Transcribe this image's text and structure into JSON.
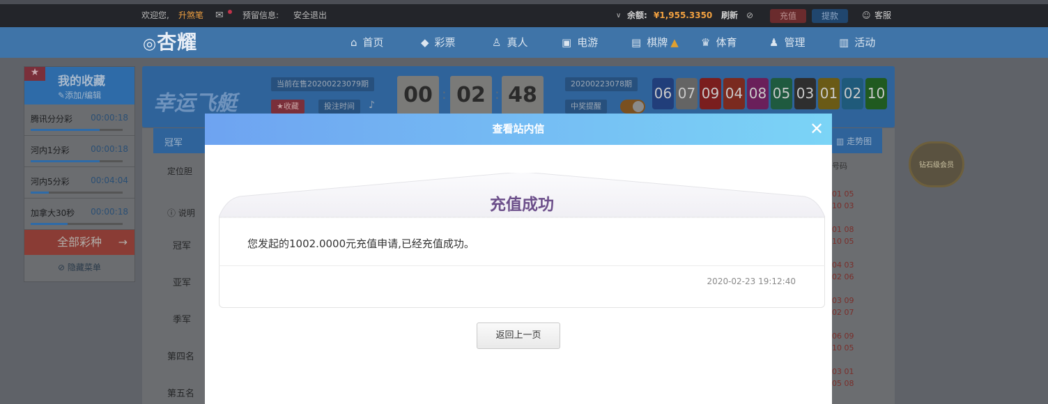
{
  "topbar": {
    "welcome": "欢迎您,",
    "username": "升煞笔",
    "notice_label": "预留信息:",
    "logout": "安全退出",
    "balance_label": "余额:",
    "balance": "¥1,955.3350",
    "refresh": "刷新",
    "recharge": "充值",
    "withdraw": "提款",
    "service": "客服"
  },
  "nav": {
    "logo": "杏耀",
    "items": [
      {
        "label": "首页",
        "icon": "home-icon",
        "glyph": "⌂"
      },
      {
        "label": "彩票",
        "icon": "ticket-icon",
        "glyph": "◆"
      },
      {
        "label": "真人",
        "icon": "person-icon",
        "glyph": "♙"
      },
      {
        "label": "电游",
        "icon": "arcade-icon",
        "glyph": "▣"
      },
      {
        "label": "棋牌",
        "icon": "cards-icon",
        "glyph": "▤"
      },
      {
        "label": "体育",
        "icon": "trophy-icon",
        "glyph": "♛"
      },
      {
        "label": "管理",
        "icon": "users-icon",
        "glyph": "♟"
      },
      {
        "label": "活动",
        "icon": "gift-icon",
        "glyph": "▥"
      }
    ]
  },
  "favorites": {
    "title": "我的收藏",
    "edit": "添加/编辑",
    "items": [
      {
        "name": "腾讯分分彩",
        "time": "00:00:18",
        "progress": 0.75
      },
      {
        "name": "河内1分彩",
        "time": "00:00:18",
        "progress": 0.75
      },
      {
        "name": "河内5分彩",
        "time": "00:04:04",
        "progress": 0.2
      },
      {
        "name": "加拿大30秒",
        "time": "00:00:18",
        "progress": 0.4
      }
    ],
    "all_games": "全部彩种",
    "hide_menu": "隐藏菜单"
  },
  "lottery": {
    "name": "幸运飞艇",
    "current_period": "当前在售20200223079期",
    "collect": "★收藏",
    "bet_time": "投注时间",
    "countdown": [
      "00",
      "02",
      "48"
    ],
    "last_period": "20200223078期",
    "win_alert": "中奖提醒",
    "balls": [
      "06",
      "07",
      "09",
      "04",
      "08",
      "05",
      "03",
      "01",
      "02",
      "10"
    ],
    "ball_colors": [
      "#213e7a",
      "#646464",
      "#7a1e1e",
      "#7a2a1f",
      "#6a1f5a",
      "#1f5a3f",
      "#2e2e2e",
      "#6a5a16",
      "#1f5a7a",
      "#205a20"
    ],
    "trend": "走势图",
    "vip": "钻石级会员"
  },
  "content": {
    "tab_champion": "冠军",
    "dingweidan": "定位胆",
    "explain": "说明",
    "rows": [
      "冠军",
      "亚军",
      "季军",
      "第四名",
      "第五名"
    ],
    "code_header": "号码",
    "codes": [
      [
        "01 05",
        "10 03"
      ],
      [
        "01 08",
        "10 05"
      ],
      [
        "04 03",
        "02 06"
      ],
      [
        "03 09",
        "02 07"
      ],
      [
        "06 09",
        "10 05"
      ],
      [
        "03 01",
        "05 08"
      ]
    ]
  },
  "modal": {
    "title": "查看站内信",
    "heading": "充值成功",
    "message": "您发起的1002.0000元充值申请,已经充值成功。",
    "date": "2020-02-23 19:12:40",
    "back": "返回上一页"
  }
}
